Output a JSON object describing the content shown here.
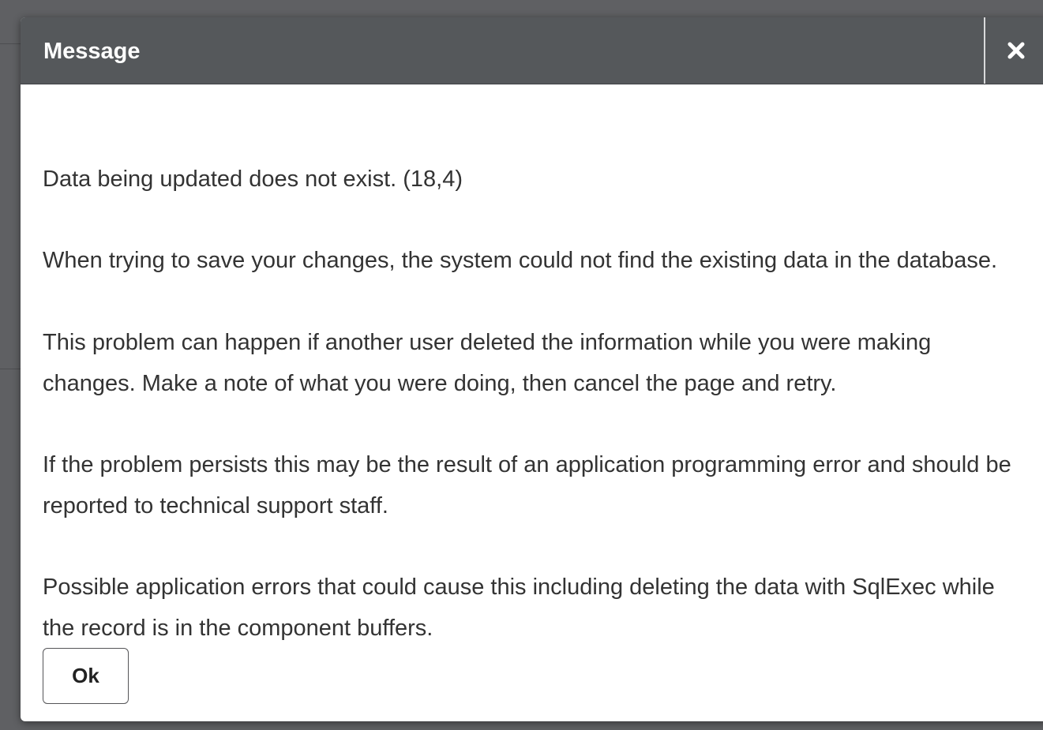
{
  "dialog": {
    "title": "Message",
    "close_icon": "close-icon",
    "message_lines": {
      "p1": "Data being updated does not exist. (18,4)",
      "p2": "When trying to save your changes, the system could not find the existing data in the database.",
      "p3_l1": "This problem can happen if another user deleted the information while you were making",
      "p3_l2": "changes. Make a note of what you were doing, then cancel the page and retry.",
      "p4_l1": "If the problem persists this may be the result of an application programming error and should be",
      "p4_l2": "reported to technical support staff.",
      "p5_l1": "Possible application errors that could cause this including deleting the data with SqlExec while",
      "p5_l2": "the record is in the component buffers."
    },
    "ok_label": "Ok"
  },
  "colors": {
    "header_bg": "#55585b",
    "header_text": "#ffffff",
    "body_text": "#333333",
    "backdrop": "#5f6063"
  }
}
